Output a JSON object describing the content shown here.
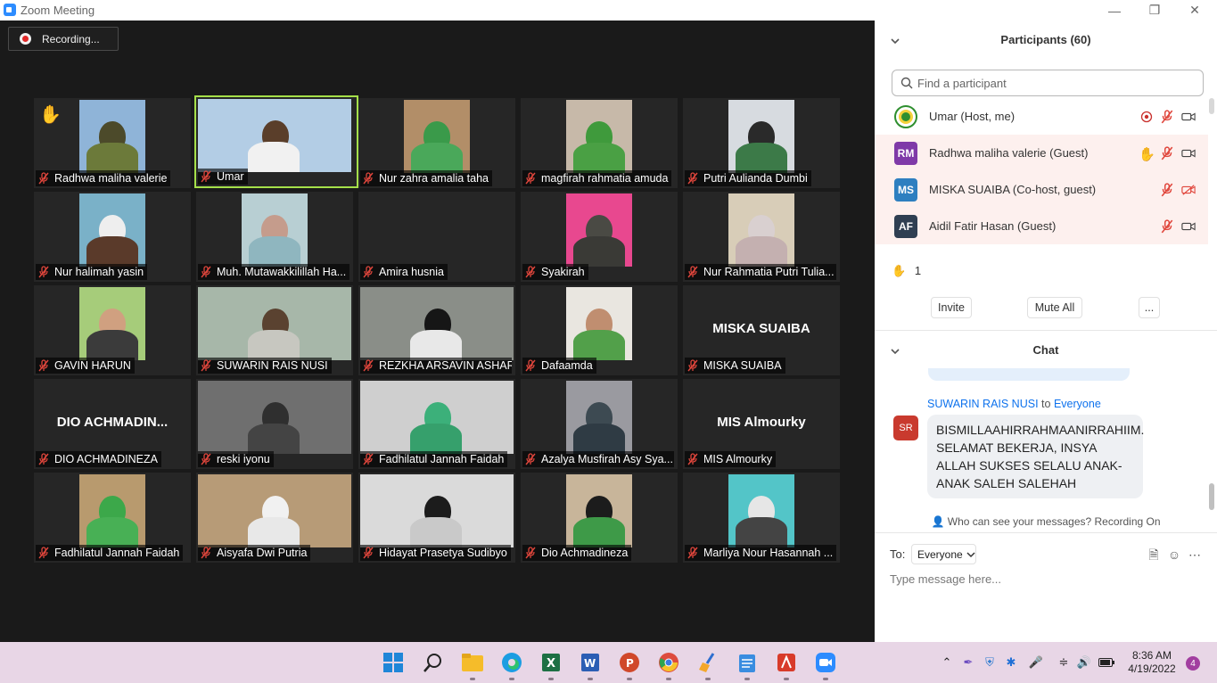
{
  "window": {
    "title": "Zoom Meeting"
  },
  "recording": {
    "label": "Recording..."
  },
  "tiles": [
    {
      "name": "Radhwa maliha valerie",
      "hand": true,
      "bg": "#8fb4d8",
      "head": "#4c4a2a",
      "body": "#6c7a3a",
      "style": "narrow"
    },
    {
      "name": "Umar",
      "active": true,
      "bg": "#b3cde5",
      "head": "#5a3e2a",
      "body": "#f1f1f1",
      "style": "wide"
    },
    {
      "name": "Nur zahra amalia taha",
      "bg": "#b28e68",
      "head": "#3a9a4a",
      "body": "#4aa85a",
      "style": "narrow"
    },
    {
      "name": "magfirah rahmatia amuda",
      "bg": "#c7b9a9",
      "head": "#3f9a3c",
      "body": "#4aa044",
      "style": "narrow"
    },
    {
      "name": "Putri Aulianda Dumbi",
      "bg": "#d7dbe0",
      "head": "#2a2a2a",
      "body": "#3c7a48",
      "style": "narrow"
    },
    {
      "name": "Nur halimah yasin",
      "bg": "#7ab1c8",
      "head": "#eeeeee",
      "body": "#5a3a2a",
      "style": "narrow"
    },
    {
      "name": "Muh. Mutawakkilillah Ha...",
      "bg": "#b8cfd3",
      "head": "#c59c8c",
      "body": "#8fb6bf",
      "style": "narrow"
    },
    {
      "name": "Amira husnia",
      "bg": "#262626",
      "head": "#262626",
      "body": "#262626",
      "style": "none"
    },
    {
      "name": "Syakirah",
      "bg": "#e8488f",
      "head": "#4a4a44",
      "body": "#3a3a36",
      "style": "narrow"
    },
    {
      "name": "Nur Rahmatia Putri Tulia...",
      "bg": "#d8cdb8",
      "head": "#d9d0d0",
      "body": "#c4b0b0",
      "style": "narrow"
    },
    {
      "name": "GAVIN HARUN",
      "bg": "#a6cc7a",
      "head": "#d0a080",
      "body": "#3b3b3b",
      "style": "narrow"
    },
    {
      "name": "SUWARIN RAIS NUSI",
      "bg": "#a7b7a9",
      "head": "#5a4230",
      "body": "#c7c7c0",
      "style": "wide"
    },
    {
      "name": "REZKHA ARSAVIN ASHAR",
      "bg": "#8a8e88",
      "head": "#161616",
      "body": "#e8e8e8",
      "style": "wide"
    },
    {
      "name": "Dafaamda",
      "bg": "#e9e6e0",
      "head": "#c08e70",
      "body": "#52a04a",
      "style": "narrow"
    },
    {
      "name": "MISKA SUAIBA",
      "bigname": "MISKA SUAIBA",
      "style": "none"
    },
    {
      "name": "DIO ACHMADINEZA",
      "bigname": "DIO  ACHMADIN...",
      "style": "none"
    },
    {
      "name": "reski iyonu",
      "bg": "#6f6f6f",
      "head": "#2f2f2f",
      "body": "#444444",
      "style": "wide"
    },
    {
      "name": "Fadhilatul Jannah Faidah",
      "bg": "#cfcfcf",
      "head": "#3cb07a",
      "body": "#36a06c",
      "style": "wide"
    },
    {
      "name": "Azalya Musfirah Asy Sya...",
      "bg": "#9a9aa0",
      "head": "#3d4a52",
      "body": "#2f3b44",
      "style": "narrow"
    },
    {
      "name": "MIS Almourky",
      "bigname": "MIS Almourky",
      "style": "none"
    },
    {
      "name": "Fadhilatul Jannah Faidah",
      "bg": "#b89a6e",
      "head": "#3ca84a",
      "body": "#48b055",
      "style": "narrow"
    },
    {
      "name": "Aisyafa Dwi Putria",
      "bg": "#b79b77",
      "head": "#f1f1f1",
      "body": "#e8e8e8",
      "style": "wide"
    },
    {
      "name": "Hidayat Prasetya Sudibyo",
      "bg": "#dadada",
      "head": "#1c1c1c",
      "body": "#c9c9c9",
      "style": "wide"
    },
    {
      "name": "Dio Achmadineza",
      "bg": "#c8b59a",
      "head": "#1c1c1c",
      "body": "#3e9a48",
      "style": "narrow"
    },
    {
      "name": "Marliya Nour Hasannah ...",
      "bg": "#53c5c8",
      "head": "#e6e6e6",
      "body": "#444444",
      "style": "narrow"
    }
  ],
  "participants": {
    "title": "Participants (60)",
    "search_placeholder": "Find a participant",
    "list": [
      {
        "name": "Umar (Host, me)",
        "initials": "",
        "avatar_color": "#2f8f2f",
        "highlight": false,
        "hand": false
      },
      {
        "name": "Radhwa maliha valerie (Guest)",
        "initials": "RM",
        "avatar_color": "#7f3aa8",
        "highlight": true,
        "hand": true
      },
      {
        "name": "MISKA SUAIBA (Co-host, guest)",
        "initials": "MS",
        "avatar_color": "#2d7fc0",
        "highlight": true,
        "hand": false
      },
      {
        "name": "Aidil Fatir Hasan (Guest)",
        "initials": "AF",
        "avatar_color": "#2f3f52",
        "highlight": true,
        "hand": false
      }
    ],
    "hands_count": "1",
    "invite": "Invite",
    "mute_all": "Mute All",
    "more": "..."
  },
  "chat": {
    "title": "Chat",
    "sender": "SUWARIN RAIS NUSI",
    "to_word": "to",
    "recipient": "Everyone",
    "sender_initials": "SR",
    "message": "BISMILLAAHIRRAHMAANIRRAHIIM. SELAMAT BEKERJA, INSYA ALLAH SUKSES SELALU ANAK-ANAK SALEH SALEHAH",
    "visibility": "Who can see your messages? Recording On",
    "to_label": "To:",
    "to_value": "Everyone",
    "input_placeholder": "Type message here..."
  },
  "taskbar": {
    "time": "8:36 AM",
    "date": "4/19/2022",
    "notifications": "4"
  }
}
